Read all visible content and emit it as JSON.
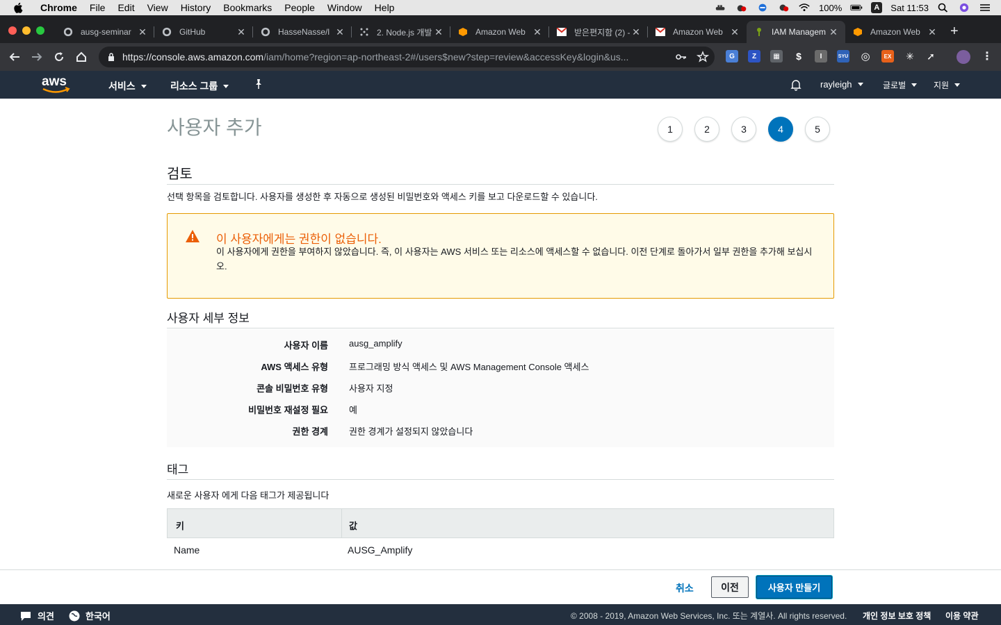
{
  "macbar": {
    "menus": [
      "Chrome",
      "File",
      "Edit",
      "View",
      "History",
      "Bookmarks",
      "People",
      "Window",
      "Help"
    ],
    "battery": "100%",
    "input_indicator": "A",
    "clock": "Sat 11:53"
  },
  "tabs": [
    {
      "title": "ausg-seminar",
      "icon": "github-icon"
    },
    {
      "title": "GitHub",
      "icon": "github-icon"
    },
    {
      "title": "HasseNasse/l",
      "icon": "github-icon"
    },
    {
      "title": "2. Node.js 개발",
      "icon": "dots-icon"
    },
    {
      "title": "Amazon Web",
      "icon": "aws-cube-icon"
    },
    {
      "title": "받은편지함 (2) -",
      "icon": "gmail-icon"
    },
    {
      "title": "Amazon Web",
      "icon": "gmail-icon"
    },
    {
      "title": "IAM Managem",
      "icon": "iam-icon"
    },
    {
      "title": "Amazon Web",
      "icon": "aws-cube-icon"
    }
  ],
  "address_bar": {
    "host": "https://console.aws.amazon.com",
    "path": "/iam/home?region=ap-northeast-2#/users$new?step=review&accessKey&login&us..."
  },
  "extensions": [
    {
      "label": "G",
      "color": "#4a7fd6"
    },
    {
      "label": "Z",
      "color": "#2d54c4"
    },
    {
      "label": "▦",
      "color": "#5f6368"
    },
    {
      "label": "$",
      "color": "#35363a"
    },
    {
      "label": "I",
      "color": "#6b6b6b"
    },
    {
      "label": "SYU",
      "color": "#2f63b8"
    },
    {
      "label": "◎",
      "color": "#35363a"
    },
    {
      "label": "EX",
      "color": "#e8611a"
    },
    {
      "label": "✳",
      "color": "#35363a"
    },
    {
      "label": "➚",
      "color": "#35363a"
    }
  ],
  "aws_nav": {
    "services": "서비스",
    "resource_groups": "리소스 그룹",
    "user": "rayleigh",
    "region": "글로벌",
    "support": "지원"
  },
  "page": {
    "title": "사용자 추가",
    "steps": [
      "1",
      "2",
      "3",
      "4",
      "5"
    ],
    "active_step": "4",
    "review_title": "검토",
    "review_desc": "선택 항목을 검토합니다. 사용자를 생성한 후 자동으로 생성된 비밀번호와 액세스 키를 보고 다운로드할 수 있습니다.",
    "warning_title": "이 사용자에게는 권한이 없습니다.",
    "warning_body": "이 사용자에게 권한을 부여하지 않았습니다. 즉, 이 사용자는 AWS 서비스 또는 리소스에 액세스할 수 없습니다. 이전 단계로 돌아가서 일부 권한을 추가해 보십시오.",
    "details_title": "사용자 세부 정보",
    "details": [
      {
        "key": "사용자 이름",
        "value": "ausg_amplify"
      },
      {
        "key": "AWS 액세스 유형",
        "value": "프로그래밍 방식 액세스 및 AWS Management Console 액세스"
      },
      {
        "key": "콘솔 비밀번호 유형",
        "value": "사용자 지정"
      },
      {
        "key": "비밀번호 재설정 필요",
        "value": "예"
      },
      {
        "key": "권한 경계",
        "value": "권한 경계가 설정되지 않았습니다"
      }
    ],
    "tags_title": "태그",
    "tags_desc": "새로운 사용자 에게 다음 태그가 제공됩니다",
    "tags_table": {
      "headers": [
        "키",
        "값"
      ],
      "rows": [
        [
          "Name",
          "AUSG_Amplify"
        ]
      ]
    }
  },
  "actions": {
    "cancel": "취소",
    "previous": "이전",
    "create": "사용자 만들기"
  },
  "footer": {
    "feedback": "의견",
    "language": "한국어",
    "copyright": "© 2008 - 2019, Amazon Web Services, Inc. 또는 계열사. All rights reserved.",
    "privacy": "개인 정보 보호 정책",
    "terms": "이용 약관"
  },
  "colors": {
    "aws_nav_bg": "#232f3e",
    "primary_button": "#0073bb",
    "warning_text": "#eb5f07",
    "warning_bg": "#fffbe8"
  }
}
